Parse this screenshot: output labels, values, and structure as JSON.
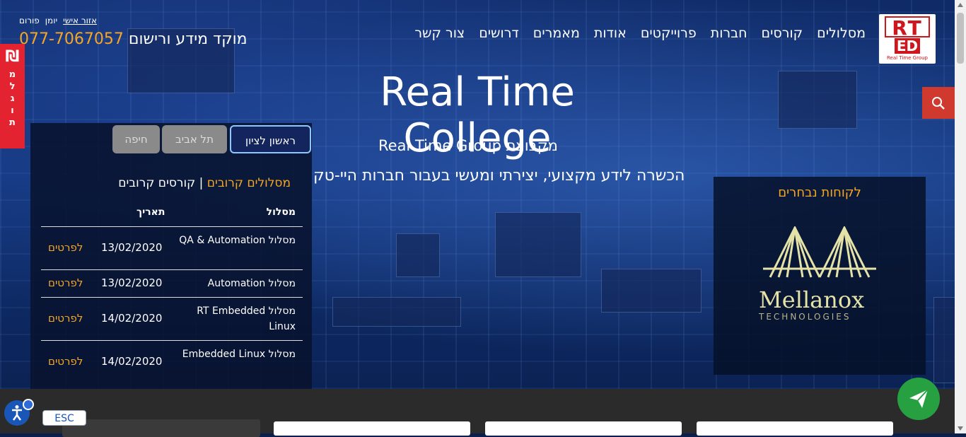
{
  "brand": {
    "logo_top": "RT",
    "logo_bottom": "ED",
    "logo_sub": "Real Time Group"
  },
  "nav": {
    "items": [
      "מסלולים",
      "קורסים",
      "חברות",
      "פרוייקטים",
      "אודות",
      "מאמרים",
      "דרושים",
      "צור קשר"
    ]
  },
  "toplinks": {
    "personal_area": "אזור אישי",
    "journal": "יומן",
    "forum": "פורום"
  },
  "contact": {
    "label": "מוקד מידע ורישום",
    "phone": "077-7067057"
  },
  "donate": {
    "symbol": "₪",
    "letters": [
      "מ",
      "ל",
      "ג",
      "ו",
      "ת"
    ]
  },
  "hero": {
    "title": "Real Time College",
    "subtitle": "Real Time Group מקבוצת",
    "tagline": "הכשרה לידע מקצועי, יצירתי ומעשי בעבור חברות היי-טק"
  },
  "courses": {
    "tabs": [
      "ראשון לציון",
      "תל אביב",
      "חיפה"
    ],
    "heading_tracks": "מסלולים קרובים",
    "heading_sep": " | ",
    "heading_courses": "קורסים קרובים",
    "col_track": "מסלול",
    "col_date": "תאריך",
    "rows": [
      {
        "name": "מסלול QA & Automation",
        "date": "13/02/2020",
        "link": "לפרטים"
      },
      {
        "name": "מסלול Automation",
        "date": "13/02/2020",
        "link": "לפרטים"
      },
      {
        "name": "מסלול RT Embedded Linux",
        "date": "14/02/2020",
        "link": "לפרטים"
      },
      {
        "name": "מסלול Embedded Linux",
        "date": "14/02/2020",
        "link": "לפרטים"
      }
    ]
  },
  "clients": {
    "heading": "לקוחות נבחרים",
    "logo_word": "Mellanox",
    "logo_tech": "TECHNOLOGIES"
  },
  "widgets": {
    "esc_label": "ESC"
  },
  "colors": {
    "accent": "#f5a623",
    "brand_red": "#d0151c",
    "search_red": "#d0392e",
    "whatsapp": "#26a041"
  }
}
